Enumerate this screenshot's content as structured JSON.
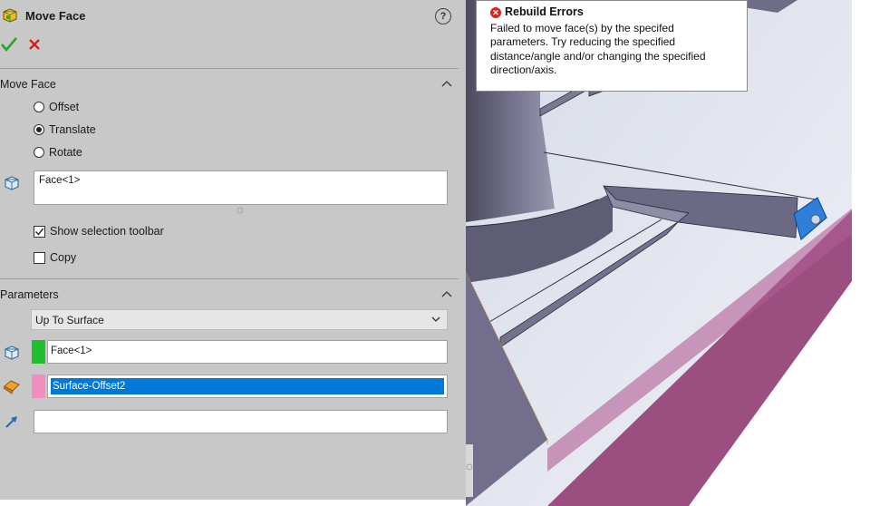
{
  "panel": {
    "title": "Move Face",
    "help_glyph": "?",
    "ok_icon": "checkmark-icon",
    "cancel_icon": "x-icon",
    "move_face_section": {
      "title": "Move Face",
      "options": [
        {
          "label": "Offset",
          "selected": false
        },
        {
          "label": "Translate",
          "selected": true
        },
        {
          "label": "Rotate",
          "selected": false
        }
      ],
      "face_field_value": "Face<1>",
      "show_selection_toolbar": {
        "label": "Show selection toolbar",
        "checked": true
      },
      "copy": {
        "label": "Copy",
        "checked": false
      }
    },
    "parameters_section": {
      "title": "Parameters",
      "end_condition": "Up To Surface",
      "face_value": "Face<1>",
      "surface_value": "Surface-Offset2",
      "direction_value": "",
      "colors": {
        "face_swatch": "#1fbf2e",
        "surface_swatch": "#f08ec0",
        "selection": "#0078d7"
      }
    }
  },
  "tooltip": {
    "title": "Rebuild Errors",
    "message": "Failed to move face(s) by the specifed parameters. Try reducing the specified distance/angle and/or changing the specified direction/axis."
  }
}
